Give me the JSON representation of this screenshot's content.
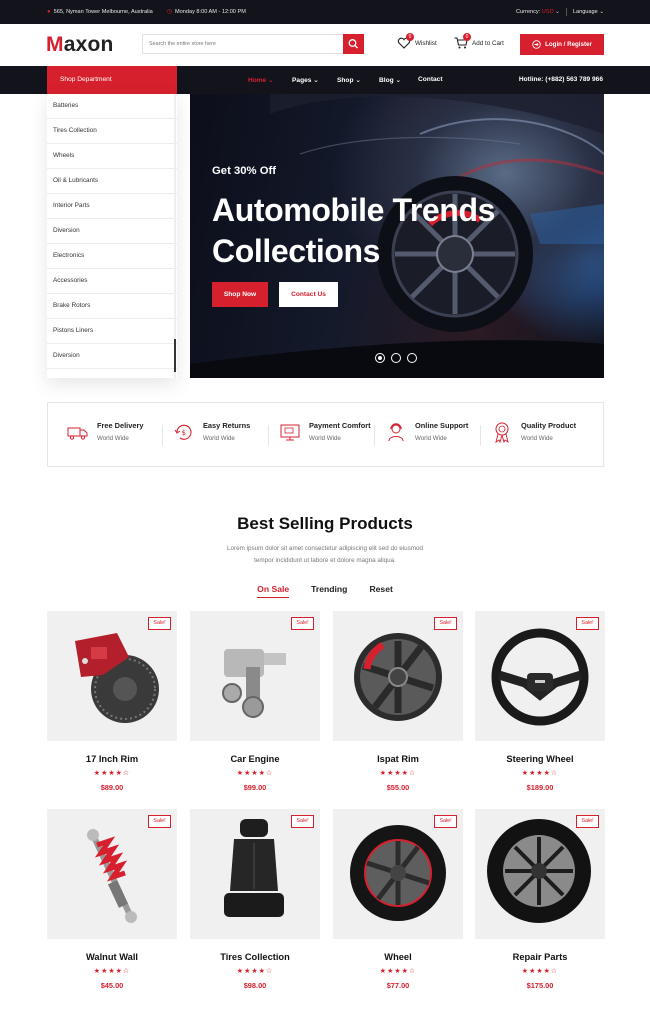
{
  "topbar": {
    "address": "565, Nyman Tower Melbourne, Australia",
    "hours": "Monday 8:00 AM - 12:00 PM",
    "currency_label": "Currency:",
    "currency_value": "USD",
    "language": "Language"
  },
  "header": {
    "logo_first": "M",
    "logo_rest": "axon",
    "search_placeholder": "Search the entire store here",
    "wishlist_label": "Wishlist",
    "wishlist_count": "0",
    "cart_label": "Add to Cart",
    "cart_count": "0",
    "login_label": "Login / Register"
  },
  "nav": {
    "shop_department": "Shop Department",
    "links": [
      "Home",
      "Pages",
      "Shop",
      "Blog",
      "Contact"
    ],
    "active_link": "Home",
    "hotline": "Hotline: (+882) 563 789 966"
  },
  "sidebar": {
    "items": [
      "Batteries",
      "Tires Collection",
      "Wheels",
      "Oil & Lubricants",
      "Interior Parts",
      "Diversion",
      "Electronics",
      "Accessories",
      "Brake Rotors",
      "Pistons Liners",
      "Diversion"
    ]
  },
  "hero": {
    "pretitle": "Get 30% Off",
    "title_line1": "Automobile Trends",
    "title_line2": "Collections",
    "shop_now": "Shop Now",
    "contact_us": "Contact Us",
    "slides": 3,
    "active_slide": 1
  },
  "features": [
    {
      "title": "Free Delivery",
      "subtitle": "World Wide",
      "icon": "delivery-truck-icon"
    },
    {
      "title": "Easy Returns",
      "subtitle": "World Wide",
      "icon": "returns-icon"
    },
    {
      "title": "Payment Comfort",
      "subtitle": "World Wide",
      "icon": "payment-icon"
    },
    {
      "title": "Online Support",
      "subtitle": "World Wide",
      "icon": "support-icon"
    },
    {
      "title": "Quality Product",
      "subtitle": "World Wide",
      "icon": "quality-badge-icon"
    }
  ],
  "best_selling": {
    "title": "Best Selling Products",
    "desc_line1": "Lorem ipsum dolor sit amet consectetur adipiscing elit sed do eiusmod",
    "desc_line2": "tempor incididunt ut labore et dolore magna aliqua.",
    "tabs": [
      "On Sale",
      "Trending",
      "Reset"
    ],
    "active_tab": "On Sale"
  },
  "products": [
    {
      "name": "17 Inch Rim",
      "price": "$89.00",
      "rating": 4,
      "badge": "Sale!",
      "icon": "brake-caliper-icon"
    },
    {
      "name": "Car Engine",
      "price": "$99.00",
      "rating": 4,
      "badge": "Sale!",
      "icon": "engine-part-icon"
    },
    {
      "name": "Ispat Rim",
      "price": "$55.00",
      "rating": 4,
      "badge": "Sale!",
      "icon": "alloy-rim-icon"
    },
    {
      "name": "Steering Wheel",
      "price": "$189.00",
      "rating": 4,
      "badge": "Sale!",
      "icon": "steering-wheel-icon"
    },
    {
      "name": "Walnut Wall",
      "price": "$45.00",
      "rating": 4,
      "badge": "Sale!",
      "icon": "shock-absorber-icon"
    },
    {
      "name": "Tires Collection",
      "price": "$98.00",
      "rating": 4,
      "badge": "Sale!",
      "icon": "car-seat-icon"
    },
    {
      "name": "Wheel",
      "price": "$77.00",
      "rating": 4,
      "badge": "Sale!",
      "icon": "wheel-icon"
    },
    {
      "name": "Repair Parts",
      "price": "$175.00",
      "rating": 4,
      "badge": "Sale!",
      "icon": "tire-icon"
    }
  ],
  "colors": {
    "accent": "#d7202e",
    "dark": "#12131b"
  }
}
